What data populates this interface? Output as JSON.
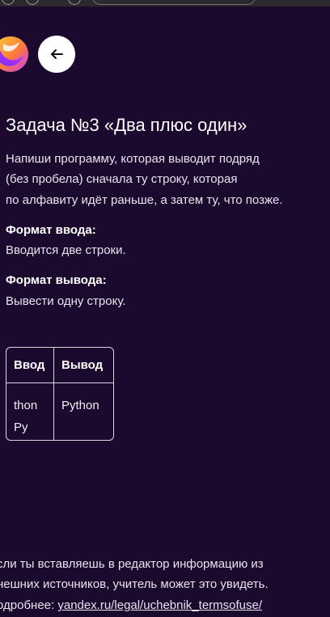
{
  "header": {
    "logo_icon": "yandex-uchebnik-logo-icon",
    "back_icon": "arrow-left-icon"
  },
  "task": {
    "title": "Задача №3 «Два плюс один»",
    "description_lines": [
      "Напиши программу, которая выводит подряд",
      "(без пробела) сначала ту строку, которая",
      "по алфавиту идёт раньше, а затем ту, что позже."
    ],
    "input_format_label": "Формат ввода:",
    "input_format_text": "Вводится две строки.",
    "output_format_label": "Формат вывода:",
    "output_format_text": "Вывести одну строку."
  },
  "example_table": {
    "headers": [
      "Ввод",
      "Вывод"
    ],
    "rows": [
      {
        "input_lines": [
          "thon",
          "Py"
        ],
        "output": "Python"
      }
    ]
  },
  "notice": {
    "line1": "сли ты вставляешь в редактор информацию из",
    "line2": "нешних источников, учитель может это увидеть.",
    "line3_prefix": "одробнее: ",
    "link_text": "yandex.ru/legal/uchebnik_termsofuse/"
  },
  "colors": {
    "background": "#1c0a2e",
    "text": "#ffffff",
    "table_border": "#d9d4e0"
  }
}
